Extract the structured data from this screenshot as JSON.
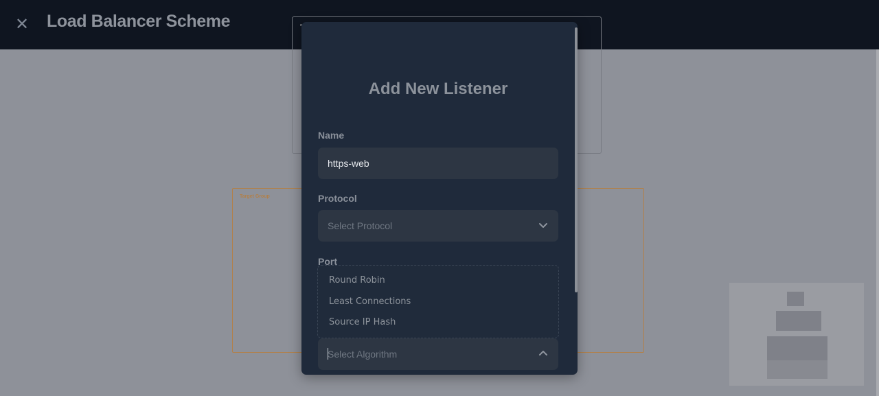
{
  "header": {
    "close_icon": "close-icon",
    "title": "Load Balancer Scheme"
  },
  "canvas": {
    "target_group_label": "Target Group"
  },
  "modal": {
    "title": "Add New Listener",
    "name": {
      "label": "Name",
      "value": "https-web"
    },
    "protocol": {
      "label": "Protocol",
      "placeholder": "Select Protocol",
      "icon": "chevron-down-icon"
    },
    "port": {
      "label": "Port"
    },
    "algorithm": {
      "placeholder": "Select Algorithm",
      "icon": "chevron-up-icon",
      "options": [
        "Round Robin",
        "Least Connections",
        "Source IP Hash"
      ]
    }
  }
}
